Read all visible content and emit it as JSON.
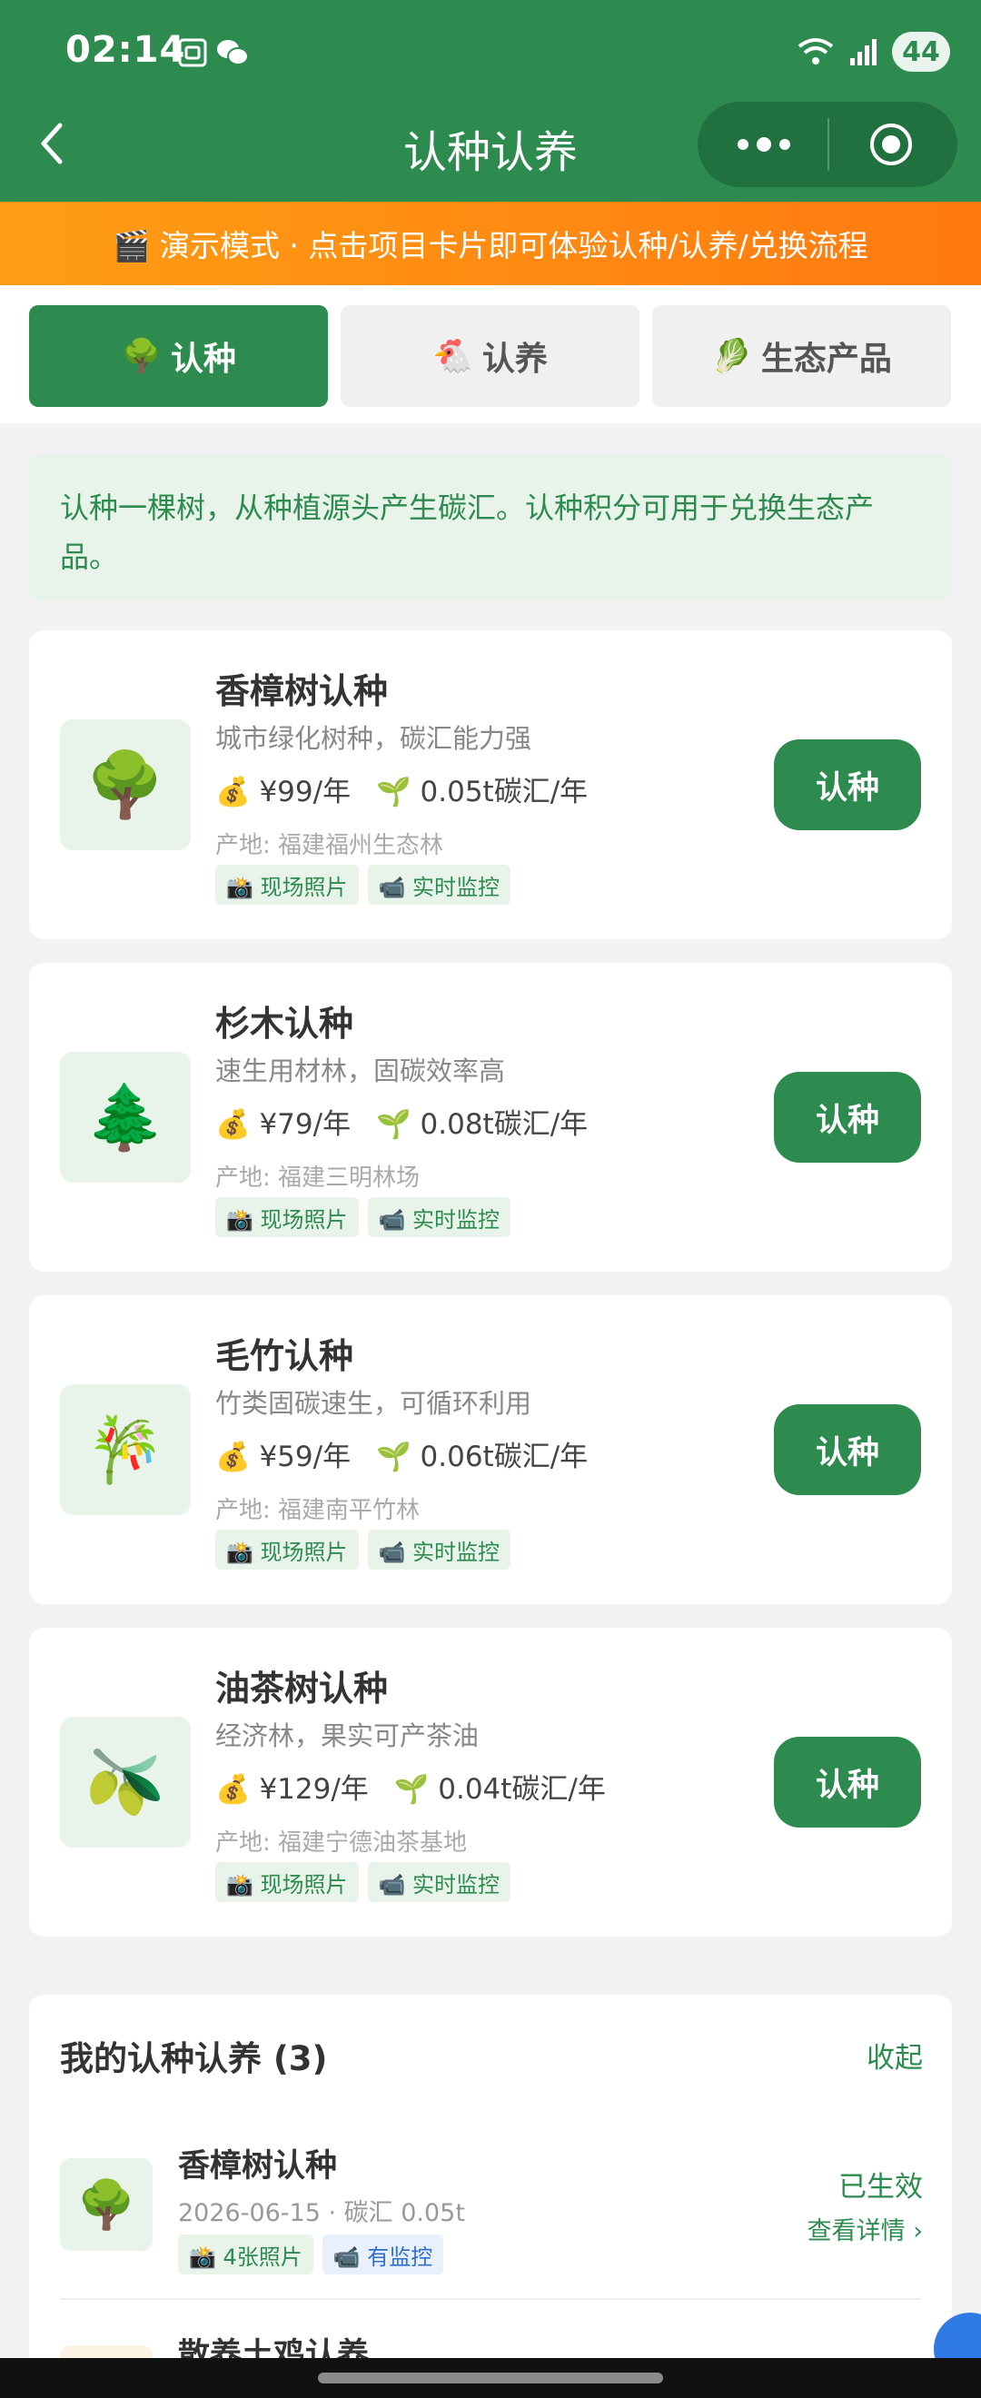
{
  "status_bar": {
    "time": "02:14",
    "battery": "44"
  },
  "nav": {
    "title": "认种认养"
  },
  "demo_banner": {
    "text": "🎬 演示模式 · 点击项目卡片即可体验认种/认养/兑换流程"
  },
  "tabs": [
    {
      "icon": "🌳",
      "label": "认种",
      "active": true
    },
    {
      "icon": "🐔",
      "label": "认养",
      "active": false
    },
    {
      "icon": "🥬",
      "label": "生态产品",
      "active": false
    }
  ],
  "intro": {
    "text": "认种一棵树，从种植源头产生碳汇。认种积分可用于兑换生态产品。"
  },
  "cards": [
    {
      "icon": "🌳",
      "title": "香樟树认种",
      "desc": "城市绿化树种，碳汇能力强",
      "price": "💰 ¥99/年",
      "carbon": "🌱 0.05t碳汇/年",
      "origin": "产地: 福建福州生态林",
      "tag1": "📸 现场照片",
      "tag2": "📹 实时监控",
      "action": "认种"
    },
    {
      "icon": "🌲",
      "title": "杉木认种",
      "desc": "速生用材林，固碳效率高",
      "price": "💰 ¥79/年",
      "carbon": "🌱 0.08t碳汇/年",
      "origin": "产地: 福建三明林场",
      "tag1": "📸 现场照片",
      "tag2": "📹 实时监控",
      "action": "认种"
    },
    {
      "icon": "🎋",
      "title": "毛竹认种",
      "desc": "竹类固碳速生，可循环利用",
      "price": "💰 ¥59/年",
      "carbon": "🌱 0.06t碳汇/年",
      "origin": "产地: 福建南平竹林",
      "tag1": "📸 现场照片",
      "tag2": "📹 实时监控",
      "action": "认种"
    },
    {
      "icon": "🫒",
      "title": "油茶树认种",
      "desc": "经济林，果实可产茶油",
      "price": "💰 ¥129/年",
      "carbon": "🌱 0.04t碳汇/年",
      "origin": "产地: 福建宁德油茶基地",
      "tag1": "📸 现场照片",
      "tag2": "📹 实时监控",
      "action": "认种"
    }
  ],
  "my_section": {
    "title": "我的认种认养 (3)",
    "collapse": "收起",
    "items": [
      {
        "icon": "🌳",
        "name": "香樟树认种",
        "sub": "2026-06-15 · 碳汇 0.05t",
        "tag1": "📸 4张照片",
        "tag2": "📹 有监控",
        "status": "已生效",
        "detail": "查看详情 ›"
      },
      {
        "name": "散养土鸡认养"
      }
    ]
  },
  "colors": {
    "primary": "#2e8b50",
    "banner": "#ff8c12",
    "light": "#e8f4ea"
  }
}
